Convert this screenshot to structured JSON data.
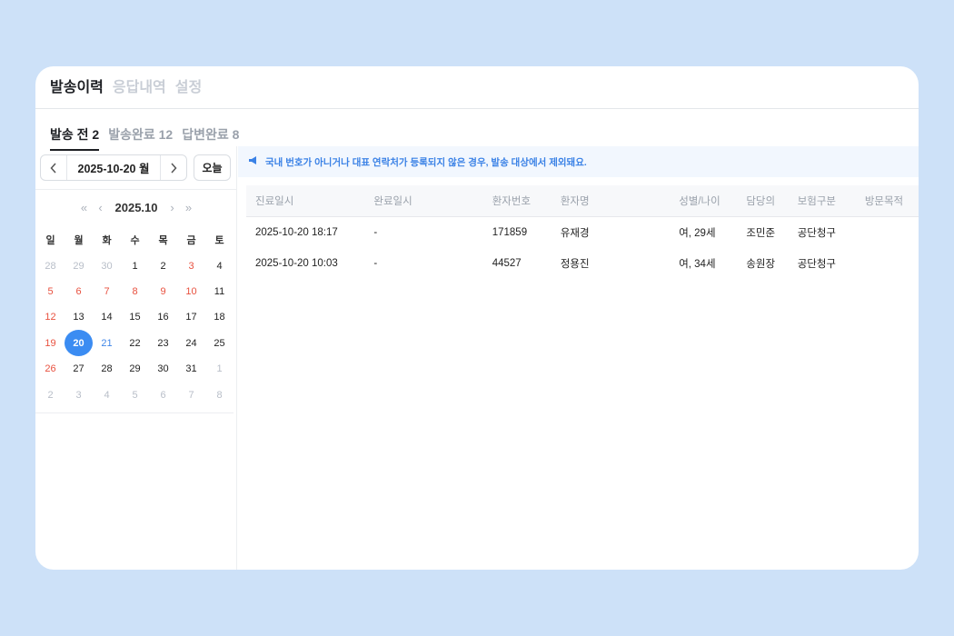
{
  "top_tabs": [
    "발송이력",
    "응답내역",
    "설정"
  ],
  "sub_tabs": [
    "발송 전 2",
    "발송완료 12",
    "답변완료 8"
  ],
  "date_nav": {
    "current": "2025-10-20 월",
    "today": "오늘",
    "prev": "‹",
    "next": "›"
  },
  "calendar": {
    "title": "2025.10",
    "prev_year": "«",
    "prev_month": "‹",
    "next_month": "›",
    "next_year": "»",
    "weekdays": [
      "일",
      "월",
      "화",
      "수",
      "목",
      "금",
      "토"
    ],
    "weeks": [
      [
        "28",
        "29",
        "30",
        "1",
        "2",
        "3",
        "4"
      ],
      [
        "5",
        "6",
        "7",
        "8",
        "9",
        "10",
        "11"
      ],
      [
        "12",
        "13",
        "14",
        "15",
        "16",
        "17",
        "18"
      ],
      [
        "19",
        "20",
        "21",
        "22",
        "23",
        "24",
        "25"
      ],
      [
        "26",
        "27",
        "28",
        "29",
        "30",
        "31",
        "1"
      ],
      [
        "2",
        "3",
        "4",
        "5",
        "6",
        "7",
        "8"
      ]
    ],
    "selected": "20"
  },
  "notice": "국내 번호가 아니거나 대표 연락처가 등록되지 않은 경우, 발송 대상에서 제외돼요.",
  "table": {
    "headers": [
      "진료일시",
      "완료일시",
      "환자번호",
      "환자명",
      "성별/나이",
      "담당의",
      "보험구분",
      "방문목적"
    ],
    "rows": [
      [
        "2025-10-20 18:17",
        "-",
        "171859",
        "유재경",
        "여, 29세",
        "조민준",
        "공단청구",
        ""
      ],
      [
        "2025-10-20 10:03",
        "-",
        "44527",
        "정용진",
        "여, 34세",
        "송원장",
        "공단청구",
        ""
      ]
    ]
  },
  "colors": {
    "accent": "#3b8cf2",
    "holiday": "#e8513f",
    "notice_bg": "#f2f7fe",
    "page_bg": "#cde1f8"
  }
}
